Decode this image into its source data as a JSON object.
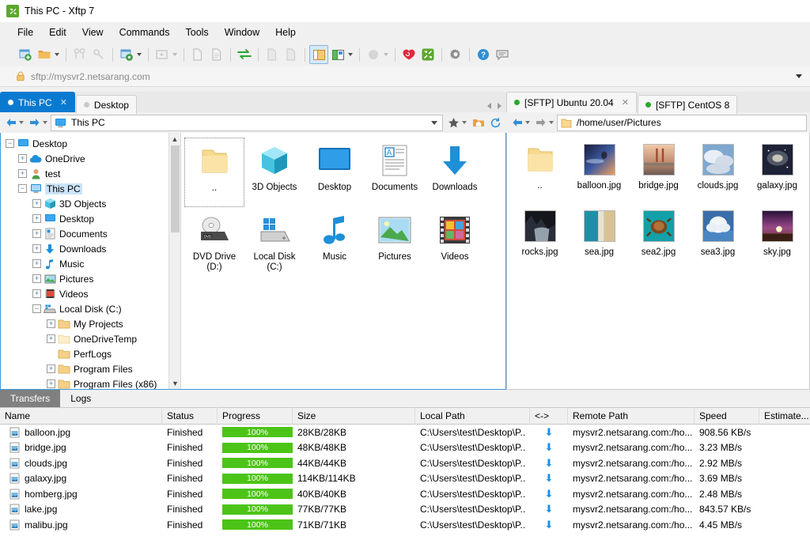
{
  "window": {
    "title": "This PC - Xftp 7",
    "logo_icon": "xftp-logo-icon"
  },
  "menubar": {
    "items": [
      "File",
      "Edit",
      "View",
      "Commands",
      "Tools",
      "Window",
      "Help"
    ]
  },
  "toolbar": {
    "buttons": [
      {
        "name": "new-session-icon",
        "label": "New"
      },
      {
        "name": "open-folder-icon",
        "label": "Open"
      },
      {
        "name": "open-dropdown-caret",
        "label": ""
      },
      {
        "name": "connect-icon",
        "label": "Connect"
      },
      {
        "name": "disconnect-icon",
        "label": "Disconnect"
      },
      {
        "name": "session-settings-icon",
        "label": "Properties"
      },
      {
        "name": "session-dropdown-caret",
        "label": ""
      },
      {
        "name": "run-icon",
        "label": "Run"
      },
      {
        "name": "run-dropdown-caret",
        "label": ""
      },
      {
        "name": "copy-file-icon",
        "label": "Copy"
      },
      {
        "name": "paste-file-icon",
        "label": "Paste"
      },
      {
        "name": "sync-transfer-icon",
        "label": "Synchronize"
      },
      {
        "name": "upload-icon",
        "label": "Upload"
      },
      {
        "name": "download-icon",
        "label": "Download"
      },
      {
        "name": "folder-view-icon",
        "label": "Folder Pane"
      },
      {
        "name": "split-view-icon",
        "label": "Layout"
      },
      {
        "name": "layout-dropdown-caret",
        "label": ""
      },
      {
        "name": "tunnel-icon",
        "label": "Tunneling"
      },
      {
        "name": "tunnel-dropdown-caret",
        "label": ""
      },
      {
        "name": "xshell-icon",
        "label": "Xshell"
      },
      {
        "name": "xftp-icon",
        "label": "Xftp"
      },
      {
        "name": "settings-gear-icon",
        "label": "Options"
      },
      {
        "name": "help-icon",
        "label": "Help"
      },
      {
        "name": "feedback-icon",
        "label": "Feedback"
      }
    ]
  },
  "urlbar": {
    "lock_icon": "lock-icon",
    "url": "sftp://mysvr2.netsarang.com",
    "dropdown_icon": "chevron-down-icon"
  },
  "local_pane": {
    "tabs": [
      {
        "label": "This PC",
        "selected": true,
        "dot": "white",
        "closable": true
      },
      {
        "label": "Desktop",
        "selected": false,
        "dot": "gray",
        "closable": false
      }
    ],
    "nav": {
      "back_icon": "back-arrow-icon",
      "forward_icon": "forward-arrow-icon",
      "address_icon": "this-pc-icon",
      "address": "This PC",
      "favorites_icon": "star-icon",
      "home_icon": "home-folder-icon",
      "refresh_icon": "refresh-icon"
    },
    "tree": [
      {
        "label": "Desktop",
        "depth": 0,
        "expander": "minus",
        "icon": "monitor-icon",
        "selected": false
      },
      {
        "label": "OneDrive",
        "depth": 1,
        "expander": "plus",
        "icon": "cloud-icon",
        "selected": false
      },
      {
        "label": "test",
        "depth": 1,
        "expander": "plus",
        "icon": "user-icon",
        "selected": false
      },
      {
        "label": "This PC",
        "depth": 1,
        "expander": "minus",
        "icon": "pc-icon",
        "selected": true
      },
      {
        "label": "3D Objects",
        "depth": 2,
        "expander": "plus",
        "icon": "cube-icon",
        "selected": false
      },
      {
        "label": "Desktop",
        "depth": 2,
        "expander": "plus",
        "icon": "monitor-icon",
        "selected": false
      },
      {
        "label": "Documents",
        "depth": 2,
        "expander": "plus",
        "icon": "document-icon",
        "selected": false
      },
      {
        "label": "Downloads",
        "depth": 2,
        "expander": "plus",
        "icon": "download-arrow-icon",
        "selected": false
      },
      {
        "label": "Music",
        "depth": 2,
        "expander": "plus",
        "icon": "music-note-icon",
        "selected": false
      },
      {
        "label": "Pictures",
        "depth": 2,
        "expander": "plus",
        "icon": "picture-icon",
        "selected": false
      },
      {
        "label": "Videos",
        "depth": 2,
        "expander": "plus",
        "icon": "video-icon",
        "selected": false
      },
      {
        "label": "Local Disk (C:)",
        "depth": 2,
        "expander": "minus",
        "icon": "harddisk-icon",
        "selected": false
      },
      {
        "label": "My Projects",
        "depth": 3,
        "expander": "plus",
        "icon": "folder-icon",
        "selected": false
      },
      {
        "label": "OneDriveTemp",
        "depth": 3,
        "expander": "plus",
        "icon": "folder-light-icon",
        "selected": false
      },
      {
        "label": "PerfLogs",
        "depth": 3,
        "expander": "none",
        "icon": "folder-icon",
        "selected": false
      },
      {
        "label": "Program Files",
        "depth": 3,
        "expander": "plus",
        "icon": "folder-icon",
        "selected": false
      },
      {
        "label": "Program Files (x86)",
        "depth": 3,
        "expander": "plus",
        "icon": "folder-icon",
        "selected": false
      }
    ],
    "items": [
      {
        "label": "..",
        "icon": "folder-up-icon",
        "selected": true
      },
      {
        "label": "3D Objects",
        "icon": "cube-icon",
        "selected": false
      },
      {
        "label": "Desktop",
        "icon": "monitor-icon",
        "selected": false
      },
      {
        "label": "Documents",
        "icon": "document-icon",
        "selected": false
      },
      {
        "label": "Downloads",
        "icon": "download-arrow-icon",
        "selected": false
      },
      {
        "label": "DVD Drive (D:)",
        "icon": "dvd-drive-icon",
        "selected": false
      },
      {
        "label": "Local Disk (C:)",
        "icon": "harddisk-icon",
        "selected": false
      },
      {
        "label": "Music",
        "icon": "music-note-icon",
        "selected": false
      },
      {
        "label": "Pictures",
        "icon": "picture-icon",
        "selected": false
      },
      {
        "label": "Videos",
        "icon": "video-icon",
        "selected": false
      }
    ]
  },
  "remote_pane": {
    "tabs": [
      {
        "label": "[SFTP] Ubuntu 20.04",
        "selected": true,
        "dot": "green",
        "closable": true
      },
      {
        "label": "[SFTP] CentOS 8",
        "selected": false,
        "dot": "green",
        "closable": false
      }
    ],
    "nav": {
      "back_icon": "back-arrow-icon",
      "forward_icon": "forward-arrow-icon",
      "address_icon": "folder-icon",
      "address": "/home/user/Pictures"
    },
    "items": [
      {
        "label": "..",
        "icon": "folder-up-icon",
        "thumb": null
      },
      {
        "label": "balloon.jpg",
        "icon": "image-thumb",
        "thumb": "balloon"
      },
      {
        "label": "bridge.jpg",
        "icon": "image-thumb",
        "thumb": "bridge"
      },
      {
        "label": "clouds.jpg",
        "icon": "image-thumb",
        "thumb": "clouds"
      },
      {
        "label": "galaxy.jpg",
        "icon": "image-thumb",
        "thumb": "galaxy"
      },
      {
        "label": "rocks.jpg",
        "icon": "image-thumb",
        "thumb": "rocks"
      },
      {
        "label": "sea.jpg",
        "icon": "image-thumb",
        "thumb": "sea"
      },
      {
        "label": "sea2.jpg",
        "icon": "image-thumb",
        "thumb": "sea2"
      },
      {
        "label": "sea3.jpg",
        "icon": "image-thumb",
        "thumb": "sea3"
      },
      {
        "label": "sky.jpg",
        "icon": "image-thumb",
        "thumb": "sky"
      }
    ]
  },
  "bottom": {
    "tabs": [
      {
        "label": "Transfers",
        "selected": true
      },
      {
        "label": "Logs",
        "selected": false
      }
    ],
    "columns": [
      "Name",
      "Status",
      "Progress",
      "Size",
      "Local Path",
      "<->",
      "Remote Path",
      "Speed",
      "Estimate..."
    ],
    "rows": [
      {
        "name": "balloon.jpg",
        "status": "Finished",
        "progress": "100%",
        "progress_pct": 100,
        "size": "28KB/28KB",
        "local_path": "C:\\Users\\test\\Desktop\\P..",
        "direction": "download",
        "remote_path": "mysvr2.netsarang.com:/ho...",
        "speed": "908.56 KB/s",
        "estimate": ""
      },
      {
        "name": "bridge.jpg",
        "status": "Finished",
        "progress": "100%",
        "progress_pct": 100,
        "size": "48KB/48KB",
        "local_path": "C:\\Users\\test\\Desktop\\P..",
        "direction": "download",
        "remote_path": "mysvr2.netsarang.com:/ho...",
        "speed": "3.23 MB/s",
        "estimate": ""
      },
      {
        "name": "clouds.jpg",
        "status": "Finished",
        "progress": "100%",
        "progress_pct": 100,
        "size": "44KB/44KB",
        "local_path": "C:\\Users\\test\\Desktop\\P..",
        "direction": "download",
        "remote_path": "mysvr2.netsarang.com:/ho...",
        "speed": "2.92 MB/s",
        "estimate": ""
      },
      {
        "name": "galaxy.jpg",
        "status": "Finished",
        "progress": "100%",
        "progress_pct": 100,
        "size": "114KB/114KB",
        "local_path": "C:\\Users\\test\\Desktop\\P..",
        "direction": "download",
        "remote_path": "mysvr2.netsarang.com:/ho...",
        "speed": "3.69 MB/s",
        "estimate": ""
      },
      {
        "name": "homberg.jpg",
        "status": "Finished",
        "progress": "100%",
        "progress_pct": 100,
        "size": "40KB/40KB",
        "local_path": "C:\\Users\\test\\Desktop\\P..",
        "direction": "download",
        "remote_path": "mysvr2.netsarang.com:/ho...",
        "speed": "2.48 MB/s",
        "estimate": ""
      },
      {
        "name": "lake.jpg",
        "status": "Finished",
        "progress": "100%",
        "progress_pct": 100,
        "size": "77KB/77KB",
        "local_path": "C:\\Users\\test\\Desktop\\P..",
        "direction": "download",
        "remote_path": "mysvr2.netsarang.com:/ho...",
        "speed": "843.57 KB/s",
        "estimate": ""
      },
      {
        "name": "malibu.jpg",
        "status": "Finished",
        "progress": "100%",
        "progress_pct": 100,
        "size": "71KB/71KB",
        "local_path": "C:\\Users\\test\\Desktop\\P..",
        "direction": "download",
        "remote_path": "mysvr2.netsarang.com:/ho...",
        "speed": "4.45 MB/s",
        "estimate": ""
      }
    ]
  },
  "colors": {
    "accent_blue": "#0a7ad1",
    "progress_green": "#4cc417",
    "tab_selected": "#0a7ad1",
    "bottom_tab_selected": "#808080",
    "pane_border": "#3a9ae0"
  }
}
